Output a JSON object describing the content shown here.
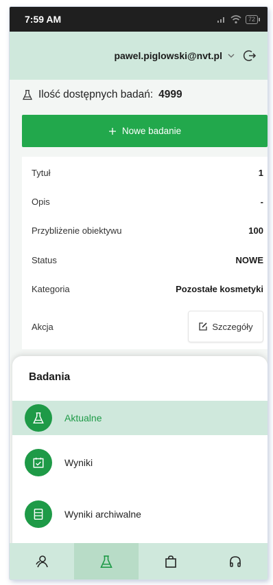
{
  "status_bar": {
    "time": "7:59 AM",
    "battery": "72"
  },
  "header": {
    "email": "pawel.piglowski@nvt.pl"
  },
  "available": {
    "label": "Ilość dostępnych badań:",
    "count": "4999"
  },
  "new_button": {
    "label": "Nowe badanie"
  },
  "details": {
    "rows": [
      {
        "label": "Tytuł",
        "value": "1"
      },
      {
        "label": "Opis",
        "value": "-"
      },
      {
        "label": "Przybliżenie obiektywu",
        "value": "100"
      },
      {
        "label": "Status",
        "value": "NOWE"
      },
      {
        "label": "Kategoria",
        "value": "Pozostałe kosmetyki"
      }
    ],
    "action_label": "Akcja",
    "action_button": "Szczegóły"
  },
  "sheet": {
    "title": "Badania",
    "items": [
      {
        "label": "Aktualne",
        "icon": "flask-icon",
        "active": true
      },
      {
        "label": "Wyniki",
        "icon": "calendar-check-icon",
        "active": false
      },
      {
        "label": "Wyniki archiwalne",
        "icon": "document-list-icon",
        "active": false
      }
    ]
  },
  "bottom_nav": {
    "items": [
      {
        "icon": "users-icon",
        "active": false
      },
      {
        "icon": "flask-icon",
        "active": true
      },
      {
        "icon": "shopping-bag-icon",
        "active": false
      },
      {
        "icon": "headphones-icon",
        "active": false
      }
    ]
  },
  "colors": {
    "accent": "#22a84c",
    "header_bg": "#cfe8dc",
    "active_nav": "#b8dcc7"
  }
}
